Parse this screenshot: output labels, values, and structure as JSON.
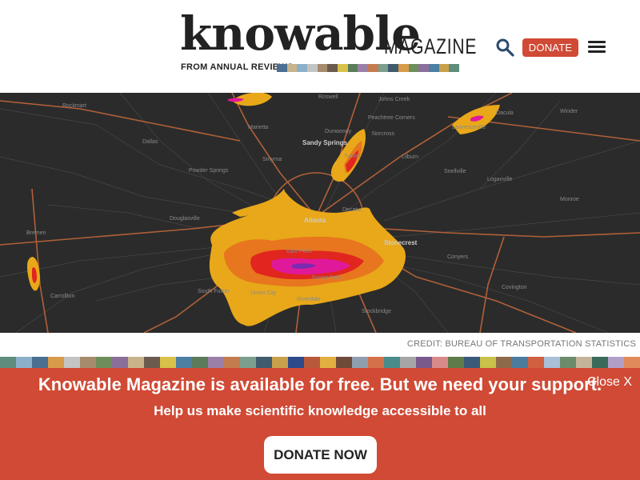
{
  "header": {
    "logo_word": "knowable",
    "logo_magazine": "MAGAZINE",
    "logo_from": "FROM ANNUAL REVIEWS",
    "logo_strip_colors": [
      "#4a6f91",
      "#c9b38b",
      "#8bb0c9",
      "#c4c4c4",
      "#a68b6d",
      "#6b5b4e",
      "#d8c24a",
      "#5a7c5a",
      "#9b7fa8",
      "#c47c4f",
      "#7b9e8f",
      "#3f5b6d",
      "#d89b4a",
      "#6d8e5a",
      "#8b6f9b",
      "#4b7fa3",
      "#c9a04a",
      "#5e8c7d"
    ],
    "donate_label": "DONATE"
  },
  "map": {
    "credit": "CREDIT: BUREAU OF TRANSPORTATION STATISTICS",
    "labels": {
      "atlanta": "Atlanta",
      "sandy_springs": "Sandy Springs",
      "stonecrest": "Stonecrest",
      "rockmart": "Rockmart",
      "roswell": "Roswell",
      "johns_creek": "Johns Creek",
      "peachtree_corners": "Peachtree Corners",
      "norcross": "Norcross",
      "dunwoody": "Dunwoody",
      "marietta": "Marietta",
      "smyrna": "Smyrna",
      "dallas": "Dallas",
      "powder_springs": "Powder Springs",
      "douglasville": "Douglasville",
      "bremen": "Bremen",
      "carrollton": "Carrollton",
      "south_fulton": "South Fulton",
      "union_city": "Union City",
      "east_point": "East Point",
      "forest_park": "Forest Park",
      "riverdale": "Riverdale",
      "stockbridge": "Stockbridge",
      "decatur": "Decatur",
      "tucker": "Tucker",
      "lilburn": "Lilburn",
      "snellville": "Snellville",
      "loganville": "Loganville",
      "lawrenceville": "Lawrenceville",
      "dacula": "Dacula",
      "winder": "Winder",
      "monroe": "Monroe",
      "conyers": "Conyers",
      "covington": "Covington"
    }
  },
  "strip_colors": [
    "#5e8c7d",
    "#8bb0c9",
    "#4a6f91",
    "#d89b4a",
    "#c4c4c4",
    "#a68b6d",
    "#6d8e5a",
    "#8b6f9b",
    "#c9b38b",
    "#6b5b4e",
    "#d8c24a",
    "#4b7fa3",
    "#5a7c5a",
    "#9b7fa8",
    "#c47c4f",
    "#7b9e8f",
    "#3f5b6d",
    "#c9a04a",
    "#2e4a8c",
    "#b85a3a",
    "#e0b040",
    "#6e4a3a",
    "#8e9eb0",
    "#d4704a",
    "#4a8c8c",
    "#a6a6a6",
    "#7a5a8c",
    "#d88a8a",
    "#5e7c4a",
    "#3a5a7a",
    "#c9c14a",
    "#8c6a4a",
    "#4a7c9e",
    "#d06040",
    "#a8c0d8",
    "#6a8c6a",
    "#c4b49a",
    "#3a6a5a",
    "#b0a0c8",
    "#e08a5a"
  ],
  "banner": {
    "title": "Knowable Magazine is available for free. But we need your support.",
    "close_label": "Close X",
    "subtitle": "Help us make scientific knowledge accessible to all",
    "donate_now_label": "DONATE NOW"
  }
}
